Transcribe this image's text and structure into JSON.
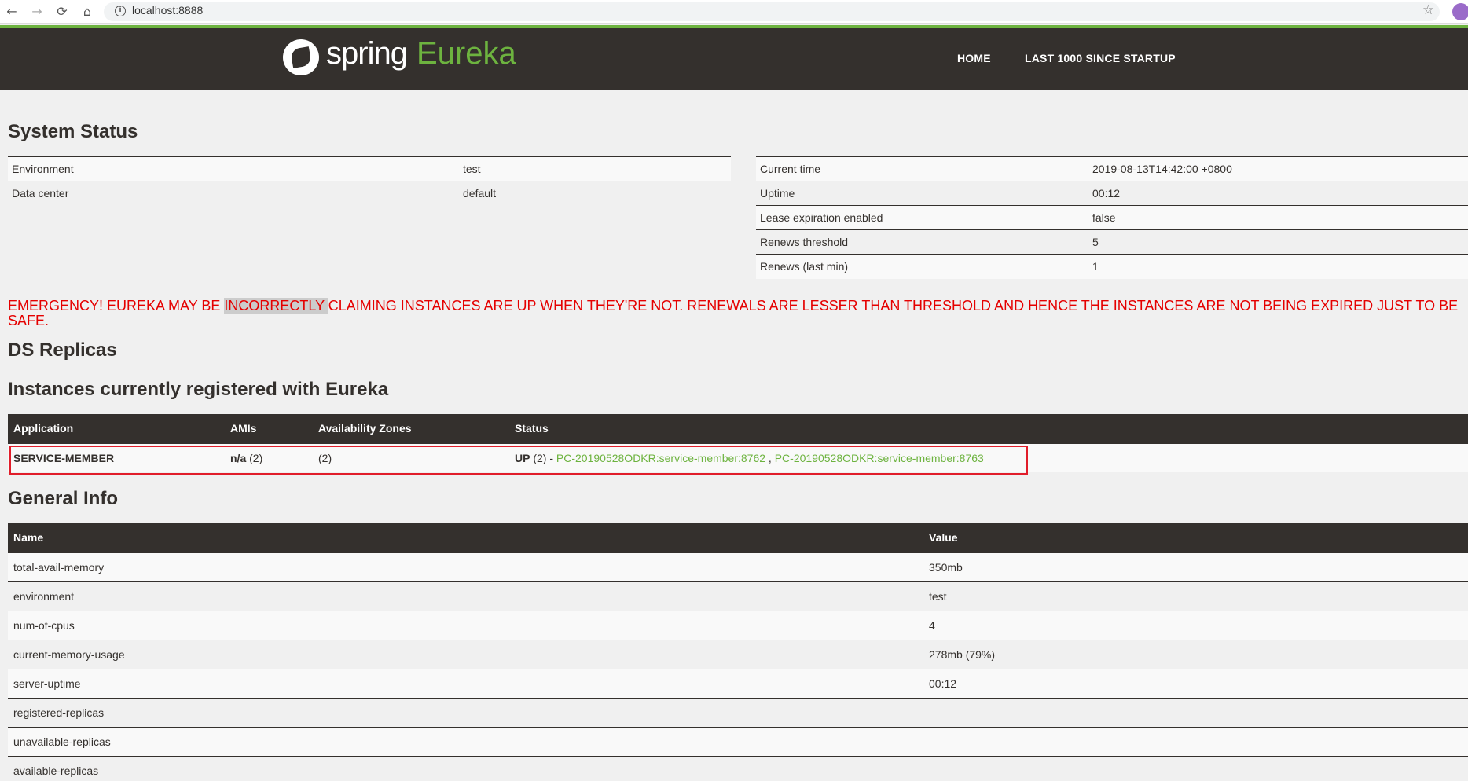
{
  "browser": {
    "url": "localhost:8888",
    "back_glyph": "←",
    "forward_glyph": "→",
    "reload_glyph": "⟳",
    "home_glyph": "⌂",
    "info_glyph": "i",
    "star_glyph": "☆"
  },
  "header": {
    "logo_spring": "spring",
    "logo_eureka": "Eureka",
    "nav": [
      "HOME",
      "LAST 1000 SINCE STARTUP"
    ],
    "accent_color": "#6db33f",
    "bar_color": "#34302d"
  },
  "system_status": {
    "title": "System Status",
    "left": [
      {
        "label": "Environment",
        "value": "test"
      },
      {
        "label": "Data center",
        "value": "default"
      }
    ],
    "right": [
      {
        "label": "Current time",
        "value": "2019-08-13T14:42:00 +0800"
      },
      {
        "label": "Uptime",
        "value": "00:12"
      },
      {
        "label": "Lease expiration enabled",
        "value": "false"
      },
      {
        "label": "Renews threshold",
        "value": "5"
      },
      {
        "label": "Renews (last min)",
        "value": "1"
      }
    ]
  },
  "emergency": {
    "part1": "EMERGENCY! EUREKA MAY BE ",
    "highlight": "INCORRECTLY ",
    "part2": "CLAIMING INSTANCES ARE UP WHEN THEY'RE NOT. RENEWALS ARE LESSER THAN THRESHOLD AND HENCE THE INSTANCES ARE NOT BEING EXPIRED JUST TO BE SAFE.",
    "color": "#e50000"
  },
  "ds_replicas": {
    "title": "DS Replicas"
  },
  "instances": {
    "title": "Instances currently registered with Eureka",
    "headers": [
      "Application",
      "AMIs",
      "Availability Zones",
      "Status"
    ],
    "rows": [
      {
        "application": "SERVICE-MEMBER",
        "amis_value": "n/a",
        "amis_count": "(2)",
        "zones": "(2)",
        "status_label": "UP",
        "status_count": "(2) -",
        "instance_1": "PC-20190528ODKR:service-member:8762",
        "separator": ",",
        "instance_2": "PC-20190528ODKR:service-member:8763"
      }
    ]
  },
  "general_info": {
    "title": "General Info",
    "headers": [
      "Name",
      "Value"
    ],
    "rows": [
      {
        "name": "total-avail-memory",
        "value": "350mb"
      },
      {
        "name": "environment",
        "value": "test"
      },
      {
        "name": "num-of-cpus",
        "value": "4"
      },
      {
        "name": "current-memory-usage",
        "value": "278mb (79%)"
      },
      {
        "name": "server-uptime",
        "value": "00:12"
      },
      {
        "name": "registered-replicas",
        "value": ""
      },
      {
        "name": "unavailable-replicas",
        "value": ""
      },
      {
        "name": "available-replicas",
        "value": ""
      }
    ]
  }
}
